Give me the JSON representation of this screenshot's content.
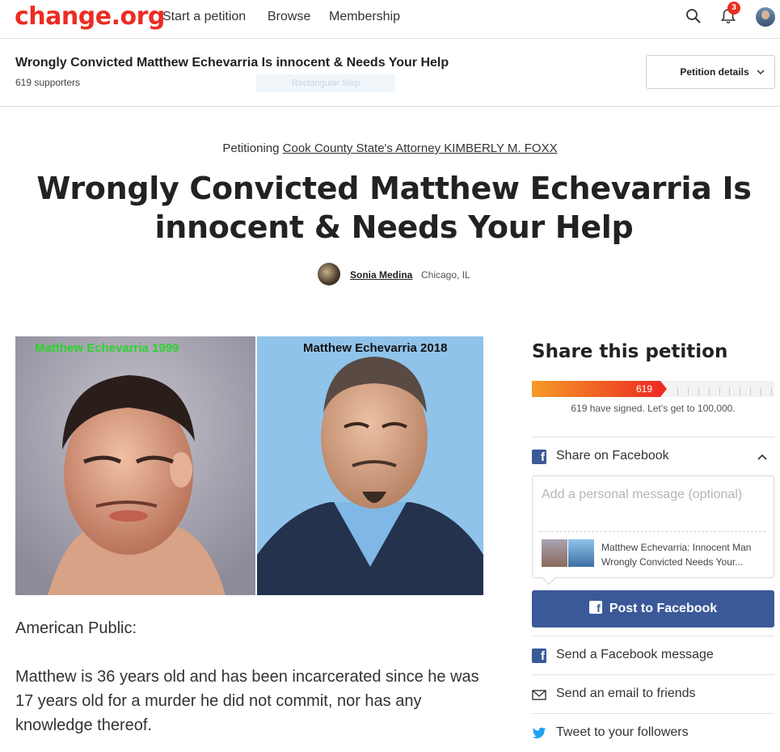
{
  "nav": {
    "logo": "change.org",
    "links": [
      "Start a petition",
      "Browse",
      "Membership"
    ],
    "notification_count": "3",
    "icons": {
      "search": "search-icon",
      "notifications": "bell-icon",
      "profile": "avatar"
    }
  },
  "sticky": {
    "title": "Wrongly Convicted Matthew Echevarria Is innocent & Needs Your Help",
    "supporters": "619 supporters",
    "snip_overlay": "Rectangular Snip",
    "details_label": "Petition details"
  },
  "petition": {
    "petitioning_prefix": "Petitioning",
    "target": "Cook County State's Attorney KIMBERLY M. FOXX",
    "title": "Wrongly Convicted Matthew Echevarria Is innocent & Needs Your Help",
    "author": "Sonia Medina",
    "location": "Chicago, IL"
  },
  "photo": {
    "caption_left": "Matthew Echevarria 1999",
    "caption_right": "Matthew Echevarria 2018"
  },
  "body": {
    "salutation": "American Public:",
    "paragraph_1": "Matthew is 36 years old and has been incarcerated since he was 17 years old for a murder he did not commit, nor has any knowledge thereof."
  },
  "share": {
    "title": "Share this petition",
    "signed_count": "619",
    "signed_fraction_shown": 0.53,
    "progress_text": "619 have signed. Let’s get to 100,000.",
    "facebook_label": "Share on Facebook",
    "message_placeholder": "Add a personal message (optional)",
    "preview_text": "Matthew Echevarria: Innocent Man Wrongly Convicted Needs Your...",
    "post_button": "Post to Facebook",
    "fb_message": "Send a Facebook message",
    "email": "Send an email to friends",
    "tweet": "Tweet to your followers"
  },
  "colors": {
    "brand_red": "#ec2c22",
    "facebook_blue": "#3b5998",
    "twitter_blue": "#1da1f2",
    "progress_start": "#f59b26"
  }
}
